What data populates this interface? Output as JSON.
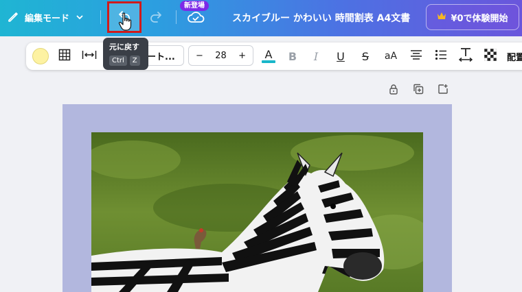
{
  "header": {
    "edit_mode_label": "編集モード",
    "new_badge": "新登場",
    "doc_title": "スカイブルー かわいい 時間割表 A4文書",
    "trial_button": "¥0で体験開始"
  },
  "tooltip": {
    "title": "元に戻す",
    "keys": [
      "Ctrl",
      "Z"
    ]
  },
  "toolbar": {
    "font_name": "ート...",
    "font_size": "28",
    "minus": "−",
    "plus": "+",
    "bold": "B",
    "italic": "I",
    "underline": "U",
    "strike": "S",
    "case": "aA",
    "position_label": "配置",
    "text_color": "#19b6c9",
    "swatch_color": "#fdf2a2"
  },
  "page": {
    "background": "#b2b7de"
  }
}
